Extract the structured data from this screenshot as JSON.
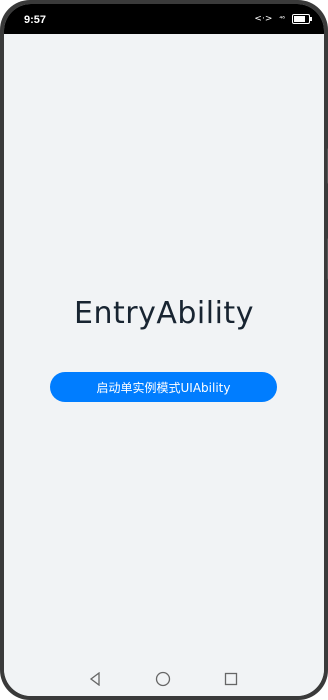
{
  "status_bar": {
    "time": "9:57",
    "data_icon_label": "<·>",
    "signal_label": "⁴⁶",
    "battery_level": 0.8
  },
  "main": {
    "title": "EntryAbility",
    "start_button_label": "启动单实例模式UIAbility"
  },
  "colors": {
    "background": "#f1f3f5",
    "button": "#007dff",
    "title_text": "#182431"
  },
  "nav_bar": {
    "back_icon": "back-triangle-icon",
    "home_icon": "home-circle-icon",
    "recent_icon": "recent-square-icon"
  }
}
